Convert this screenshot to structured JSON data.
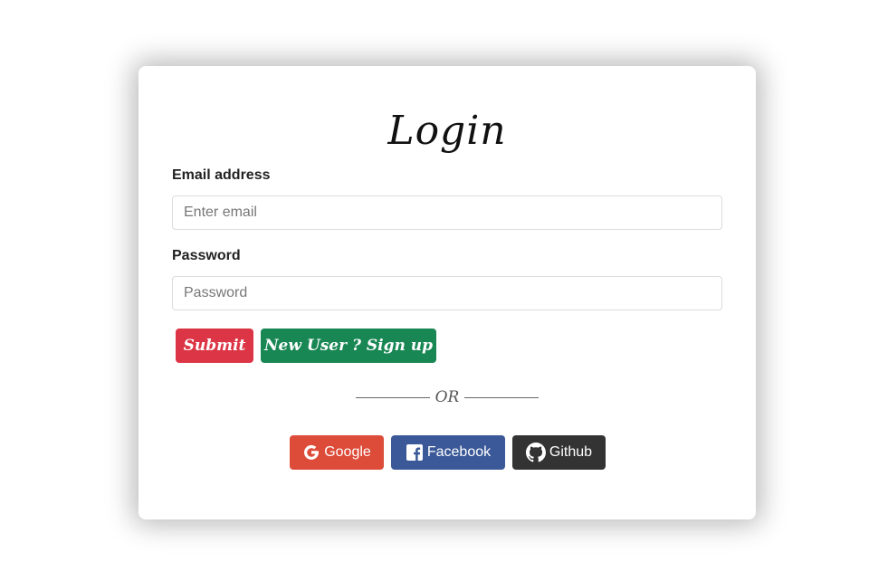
{
  "login": {
    "title": "Login",
    "email": {
      "label": "Email address",
      "placeholder": "Enter email",
      "value": ""
    },
    "password": {
      "label": "Password",
      "placeholder": "Password",
      "value": ""
    },
    "submit_label": "Submit",
    "signup_label": "New User ? Sign up",
    "or_label": "OR",
    "social": {
      "google": {
        "label": "Google",
        "icon": "google-icon",
        "color": "#dd4b39"
      },
      "facebook": {
        "label": "Facebook",
        "icon": "facebook-icon",
        "color": "#3b5998"
      },
      "github": {
        "label": "Github",
        "icon": "github-icon",
        "color": "#333333"
      }
    },
    "colors": {
      "submit": "#dc3545",
      "signup": "#198754"
    }
  }
}
